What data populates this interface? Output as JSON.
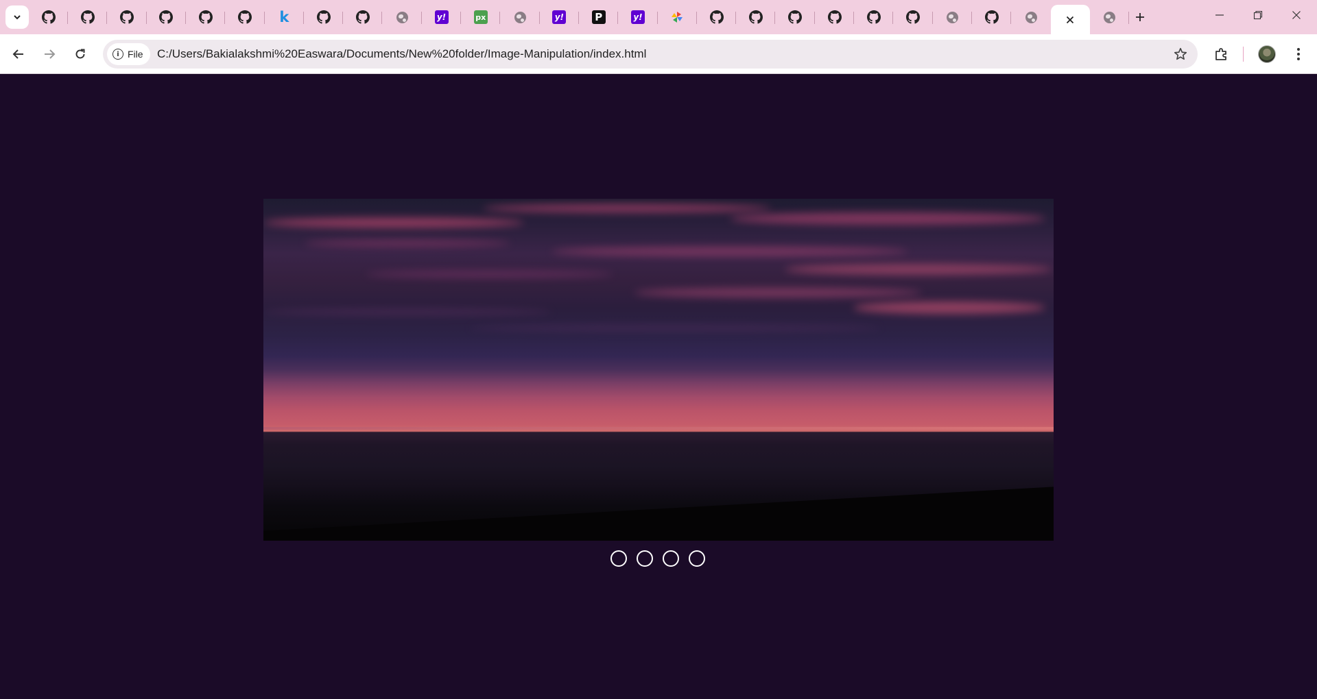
{
  "browser": {
    "tabs": [
      {
        "icon": "github-icon"
      },
      {
        "icon": "github-icon"
      },
      {
        "icon": "github-icon"
      },
      {
        "icon": "github-icon"
      },
      {
        "icon": "github-icon"
      },
      {
        "icon": "github-icon"
      },
      {
        "icon": "k-icon",
        "glyph": "k"
      },
      {
        "icon": "github-icon"
      },
      {
        "icon": "github-icon"
      },
      {
        "icon": "globe-icon"
      },
      {
        "icon": "yahoo-icon",
        "glyph": "y!"
      },
      {
        "icon": "px-icon",
        "glyph": "px"
      },
      {
        "icon": "globe-icon"
      },
      {
        "icon": "yahoo-icon",
        "glyph": "y!"
      },
      {
        "icon": "p-icon",
        "glyph": "P"
      },
      {
        "icon": "yahoo-icon",
        "glyph": "y!"
      },
      {
        "icon": "pinwheel-icon"
      },
      {
        "icon": "github-icon"
      },
      {
        "icon": "github-icon"
      },
      {
        "icon": "github-icon"
      },
      {
        "icon": "github-icon"
      },
      {
        "icon": "github-icon"
      },
      {
        "icon": "github-icon"
      },
      {
        "icon": "globe-icon"
      },
      {
        "icon": "github-icon"
      },
      {
        "icon": "globe-icon"
      },
      {
        "icon": "close-icon",
        "active": true
      },
      {
        "icon": "globe-icon"
      }
    ],
    "address_bar": {
      "chip_label": "File",
      "url": "C:/Users/Bakialakshmi%20Easwara/Documents/New%20folder/Image-Manipulation/index.html"
    }
  },
  "page": {
    "background_color": "#1b0b28",
    "slideshow": {
      "image_description_icon": "sunset-ocean-image",
      "dots": [
        {
          "active": false
        },
        {
          "active": false
        },
        {
          "active": false
        },
        {
          "active": false
        }
      ]
    }
  }
}
